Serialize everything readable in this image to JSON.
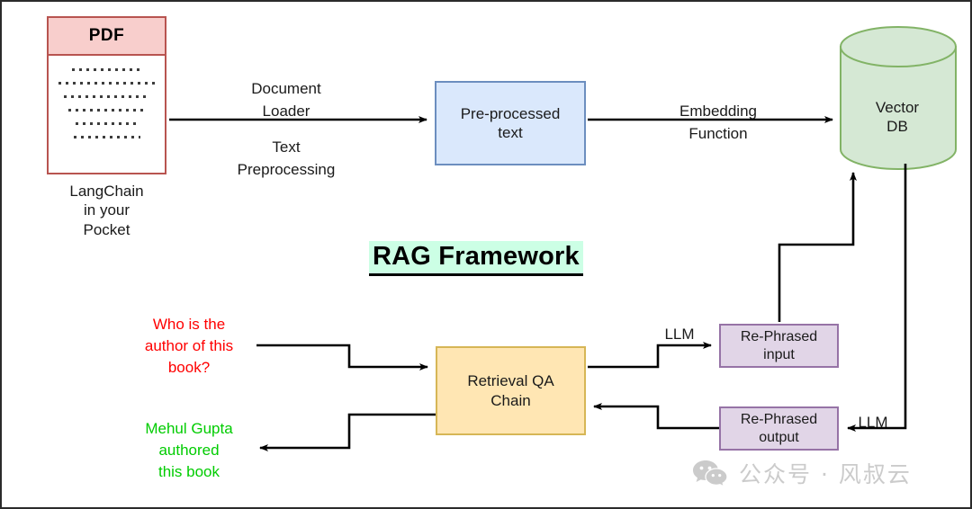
{
  "diagram": {
    "title": "RAG Framework",
    "title_colors": {
      "text": "#000000",
      "highlight": "#ccffe5"
    }
  },
  "pdf": {
    "header_label": "PDF",
    "caption": "LangChain\nin your\nPocket",
    "line_widths": [
      78,
      108,
      96,
      86,
      70,
      74
    ],
    "colors": {
      "fill": "#f8cecc",
      "stroke": "#b85450"
    }
  },
  "nodes": {
    "preprocessed": {
      "label": "Pre-processed\ntext",
      "colors": {
        "fill": "#dae8fc",
        "stroke": "#6c8ebf"
      }
    },
    "vector_db": {
      "label": "Vector\nDB",
      "colors": {
        "fill": "#d5e8d4",
        "stroke": "#82b366"
      }
    },
    "qa_chain": {
      "label": "Retrieval QA\nChain",
      "colors": {
        "fill": "#ffe6b3",
        "stroke": "#d6b656"
      }
    },
    "rephrased_input": {
      "label": "Re-Phrased\ninput",
      "colors": {
        "fill": "#e1d5e7",
        "stroke": "#9673a6"
      }
    },
    "rephrased_output": {
      "label": "Re-Phrased\noutput",
      "colors": {
        "fill": "#e1d5e7",
        "stroke": "#9673a6"
      }
    }
  },
  "edge_labels": {
    "document_loader": "Document\nLoader",
    "text_preprocessing": "Text\nPreprocessing",
    "embedding_function": "Embedding\nFunction",
    "llm_top": "LLM",
    "llm_bottom": "LLM"
  },
  "io": {
    "query": "Who is the\nauthor of this\nbook?",
    "query_color": "#ff0000",
    "answer": "Mehul Gupta\nauthored\nthis book",
    "answer_color": "#00cc00"
  },
  "watermark": {
    "text": "公众号 · 风叔云",
    "color": "#c9c9c9"
  }
}
